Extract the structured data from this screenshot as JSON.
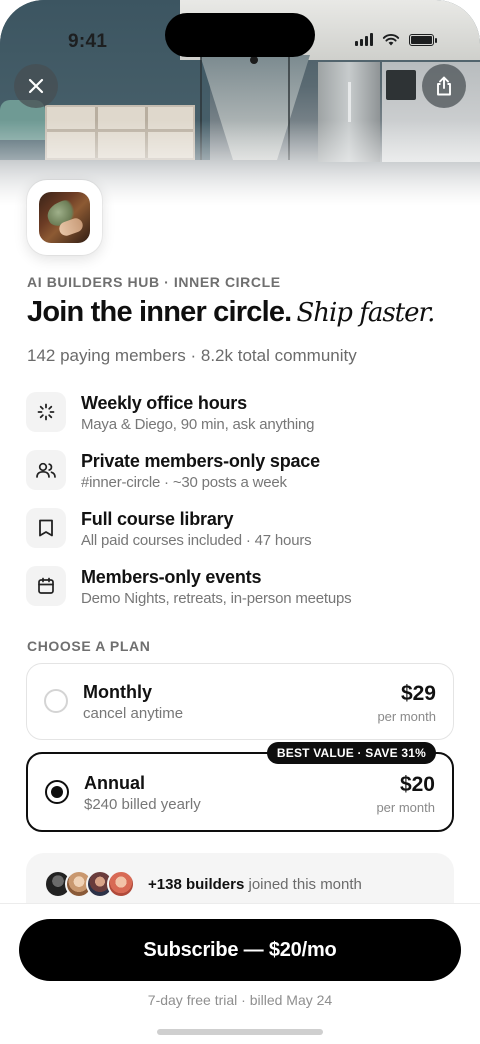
{
  "status_bar": {
    "time": "9:41"
  },
  "header": {
    "close_icon": "close-icon",
    "share_icon": "share-icon"
  },
  "community": {
    "eyebrow": "AI BUILDERS HUB · INNER CIRCLE",
    "headline_bold": "Join the inner circle.",
    "headline_script": "Ship faster.",
    "members_line": "142 paying members · 8.2k total community"
  },
  "features": [
    {
      "icon": "sparkle-icon",
      "title": "Weekly office hours",
      "subtitle": "Maya & Diego, 90 min, ask anything"
    },
    {
      "icon": "users-icon",
      "title": "Private members-only space",
      "subtitle": "#inner-circle · ~30 posts a week"
    },
    {
      "icon": "book-icon",
      "title": "Full course library",
      "subtitle": "All paid courses included · 47 hours"
    },
    {
      "icon": "calendar-icon",
      "title": "Members-only events",
      "subtitle": "Demo Nights, retreats, in-person meetups"
    }
  ],
  "plans": {
    "label": "CHOOSE A PLAN",
    "monthly": {
      "name": "Monthly",
      "note": "cancel anytime",
      "price": "$29",
      "per": "per month",
      "selected": false
    },
    "annual": {
      "name": "Annual",
      "note": "$240 billed yearly",
      "price": "$20",
      "per": "per month",
      "badge": "BEST VALUE · SAVE 31%",
      "selected": true
    }
  },
  "social_proof": {
    "count": "+138 builders",
    "rest": " joined this month"
  },
  "footer": {
    "cta": "Subscribe — $20/mo",
    "fine_print": "7-day free trial · billed May 24"
  },
  "colors": {
    "accent": "#000000",
    "muted": "#777777",
    "card_bg": "#f5f5f5"
  }
}
